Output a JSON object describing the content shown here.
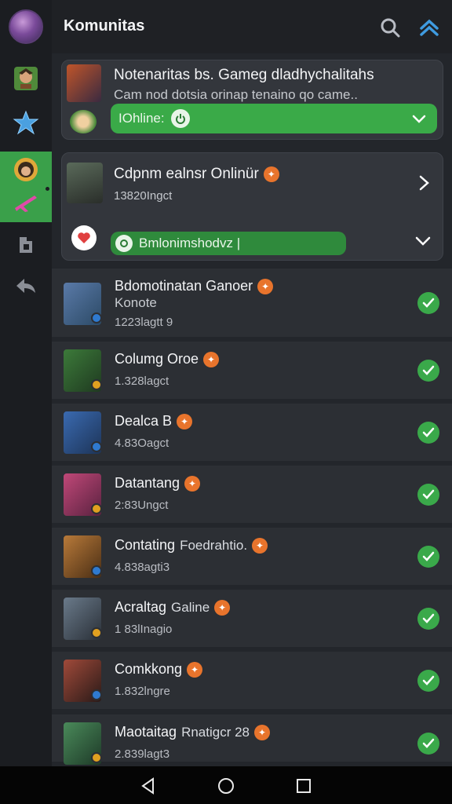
{
  "topbar": {
    "title": "Komunitas"
  },
  "card1": {
    "title": "Notenaritas bs. Gameg dladhychalitahs",
    "subtitle": "Cam nod dotsia orinap tenaino qo came..",
    "pill_label": "IOhline:"
  },
  "card2": {
    "title": "Cdpnm ealnsr Onlinür",
    "meta": "13820Ingct",
    "pill_label": "Bmlonimshodvz |"
  },
  "rows": [
    {
      "title": "Bdomotinatan Ganoer",
      "sub": "Konote",
      "meta": "1223lagtt 9",
      "extra": "",
      "colors": [
        "#5a7aa8",
        "#2c4a66"
      ]
    },
    {
      "title": "Columg Oroe",
      "sub": "",
      "meta": "1.328lagct",
      "extra": "",
      "colors": [
        "#3c7a3a",
        "#1f3a20"
      ]
    },
    {
      "title": "Dealca B",
      "sub": "",
      "meta": "4.83Oagct",
      "extra": "",
      "colors": [
        "#3a6ab0",
        "#1d3458"
      ]
    },
    {
      "title": "Datantang",
      "sub": "",
      "meta": "2:83Ungct",
      "extra": "",
      "colors": [
        "#c04878",
        "#5a2240"
      ]
    },
    {
      "title": "Contating",
      "sub": "",
      "meta": "4.838agti3",
      "extra": "Foedrahtio.",
      "colors": [
        "#b87a3a",
        "#4a2e14"
      ]
    },
    {
      "title": "Acraltag",
      "sub": "",
      "meta": "1 83lInagio",
      "extra": "Galine",
      "colors": [
        "#6a7a8a",
        "#2a3038"
      ]
    },
    {
      "title": "Comkkong",
      "sub": "",
      "meta": "1.832lngre",
      "extra": "",
      "colors": [
        "#a04a3a",
        "#2a1a18"
      ]
    },
    {
      "title": "Maotaitag",
      "sub": "",
      "meta": "2.839lagt3",
      "extra": "Rnatigcr 28",
      "colors": [
        "#4a8a5a",
        "#1e3a28"
      ]
    }
  ],
  "icons": {
    "search": "search-icon",
    "up": "chevron-up-icon",
    "check": "check-icon"
  },
  "colors": {
    "accent": "#3aaa48",
    "badge": "#e8742c",
    "link": "#3f9be0"
  }
}
